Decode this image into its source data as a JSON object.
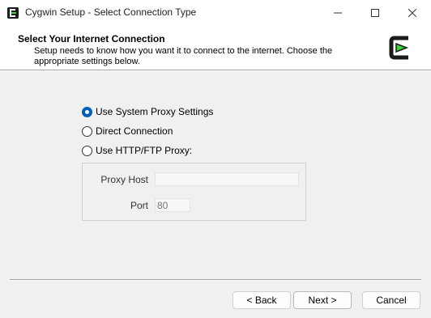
{
  "window": {
    "title": "Cygwin Setup - Select Connection Type",
    "app_icon": "cygwin-logo-icon"
  },
  "header": {
    "title": "Select Your Internet Connection",
    "description": "Setup needs to know how you want it to connect to the internet.  Choose the appropriate settings below."
  },
  "options": [
    {
      "label": "Use System Proxy Settings",
      "checked": true
    },
    {
      "label": "Direct Connection",
      "checked": false
    },
    {
      "label": "Use HTTP/FTP Proxy:",
      "checked": false
    }
  ],
  "proxy": {
    "host_label": "Proxy Host",
    "host_value": "",
    "port_label": "Port",
    "port_value": "80"
  },
  "buttons": {
    "back": "< Back",
    "next": "Next >",
    "cancel": "Cancel"
  },
  "colors": {
    "accent": "#005fb8",
    "logo_green": "#3ad13a",
    "logo_dark": "#1a1a1a"
  }
}
